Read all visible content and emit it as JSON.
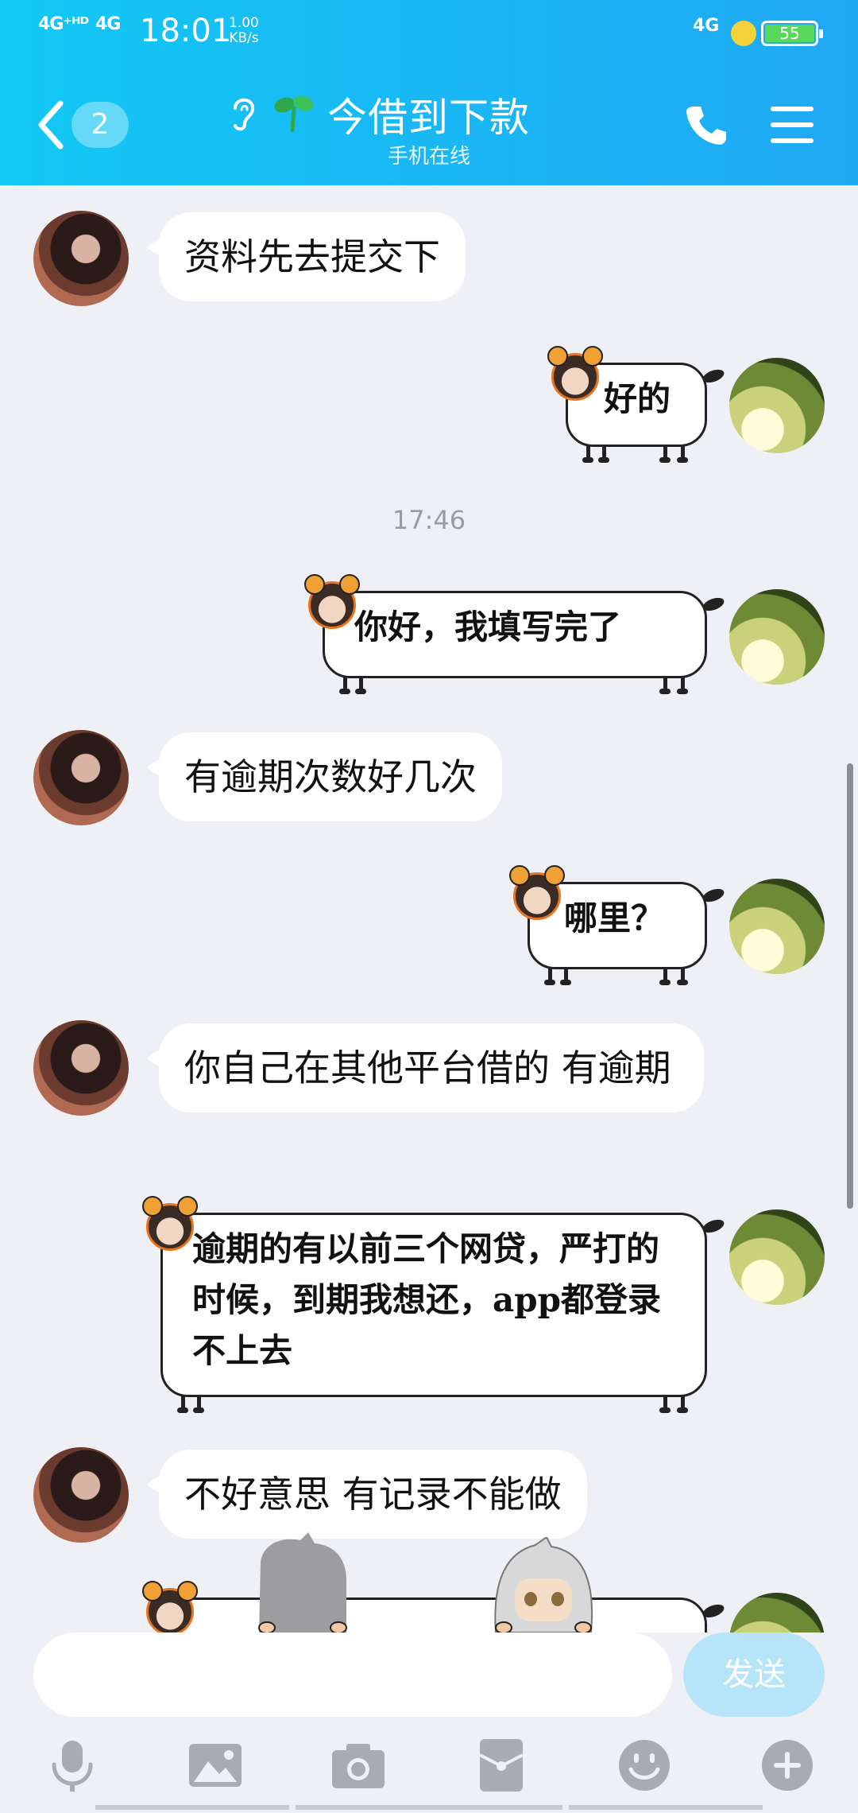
{
  "status_bar": {
    "signal_left": "4G⁺ᴴᴰ",
    "signal_right": "4G",
    "time": "18:01",
    "speed_value": "1.00",
    "speed_unit": "KB/s",
    "network": "4G",
    "battery": "55"
  },
  "header": {
    "unread_count": "2",
    "title": "今借到下款",
    "subtitle": "手机在线"
  },
  "messages": [
    {
      "side": "left",
      "style": "bubble",
      "text": "资料先去提交下"
    },
    {
      "side": "right",
      "style": "sheep",
      "text": "好的"
    },
    {
      "type": "time",
      "text": "17:46"
    },
    {
      "side": "right",
      "style": "sheep",
      "text": "你好，我填写完了"
    },
    {
      "side": "left",
      "style": "bubble",
      "text": "有逾期次数好几次"
    },
    {
      "side": "right",
      "style": "sheep",
      "text": "哪里？"
    },
    {
      "side": "left",
      "style": "bubble",
      "text": "你自己在其他平台借的 有逾期"
    },
    {
      "side": "right",
      "style": "sheep",
      "text": "逾期的有以前三个网贷，严打的时候，到期我想还，app都登录不上去"
    },
    {
      "side": "left",
      "style": "bubble",
      "text": "不好意思 有记录不能做"
    }
  ],
  "input": {
    "placeholder": "",
    "send_label": "发送"
  },
  "toolbar": [
    "voice-icon",
    "image-icon",
    "camera-icon",
    "red-packet-icon",
    "emoji-icon",
    "plus-icon"
  ],
  "colors": {
    "header_start": "#12c8f4",
    "header_end": "#20a9f3",
    "chat_bg": "#eef0f6",
    "send_button": "#b6e5fa",
    "toolbar_icon": "#a9aab3"
  }
}
